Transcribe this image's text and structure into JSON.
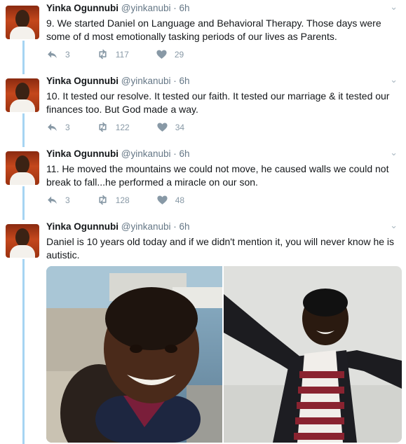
{
  "author": {
    "name": "Yinka Ogunnubi",
    "handle": "@yinkanubi",
    "separator": "·",
    "time": "6h"
  },
  "tweets": [
    {
      "text": "9. We started Daniel on Language and Behavioral Therapy. Those days were some of d most emotionally tasking periods of our lives as Parents.",
      "replies": "3",
      "retweets": "117",
      "likes": "29"
    },
    {
      "text": "10. It tested our resolve. It tested our faith. It tested our marriage & it tested our finances too. But God made a way.",
      "replies": "3",
      "retweets": "122",
      "likes": "34"
    },
    {
      "text": "11. He moved the mountains we could not move, he caused walls we could not break to fall...he performed a miracle on our son.",
      "replies": "3",
      "retweets": "128",
      "likes": "48"
    },
    {
      "text": "Daniel is 10 years old today and if we didn't mention it, you will never know he is autistic."
    }
  ],
  "media": [
    {
      "name": "photo-boy-smiling-marina"
    },
    {
      "name": "photo-boy-arms-outstretched"
    }
  ],
  "colors": {
    "thread_line": "#a6d4f2",
    "icon_gray": "#8899a6",
    "text": "#14171a",
    "secondary": "#657786"
  },
  "icons": [
    "reply-icon",
    "retweet-icon",
    "like-icon",
    "chevron-down-icon"
  ]
}
